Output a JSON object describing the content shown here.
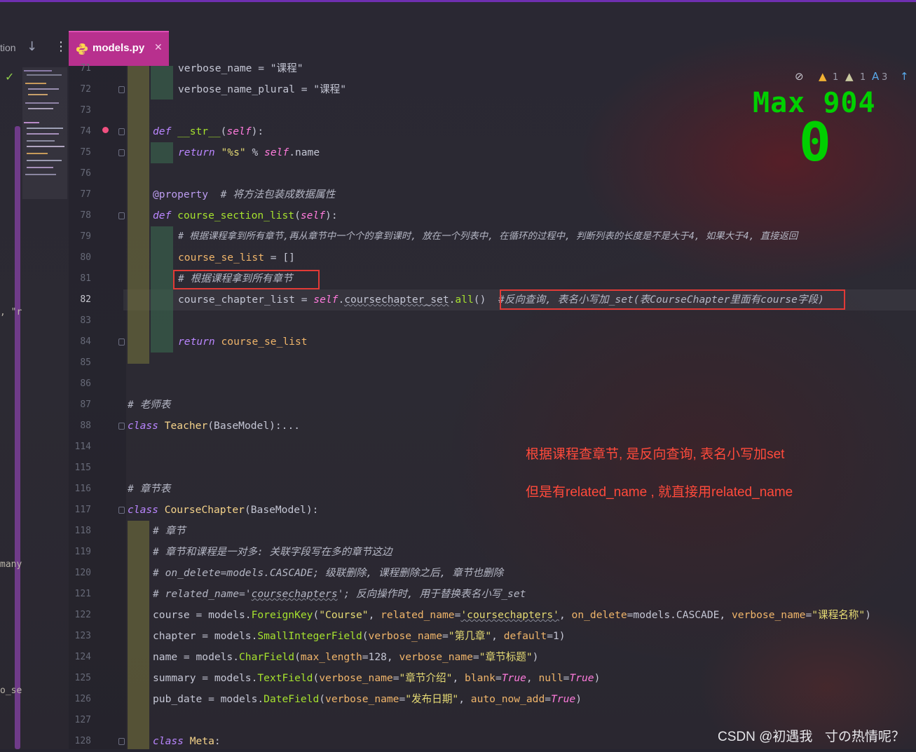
{
  "tabs": {
    "previous_label": "tion",
    "active_label": "models.py"
  },
  "left_fragments": [
    ", \"r",
    "many",
    "o_se"
  ],
  "inspections": {
    "warn1": "1",
    "warn2": "1",
    "typo": "3"
  },
  "overlay": {
    "max_label": "Max 904",
    "counter": "0"
  },
  "line_numbers": [
    "71",
    "72",
    "73",
    "74",
    "75",
    "76",
    "77",
    "78",
    "79",
    "80",
    "81",
    "82",
    "83",
    "84",
    "85",
    "86",
    "87",
    "88",
    "114",
    "115",
    "116",
    "117",
    "118",
    "119",
    "120",
    "121",
    "122",
    "123",
    "124",
    "125",
    "126",
    "127",
    "128"
  ],
  "code": {
    "l71": "verbose_name = \"课程\"",
    "l72": "verbose_name_plural = \"课程\"",
    "l74_kw": "def",
    "l74_fn": "__str__",
    "l74_self": "self",
    "l75_kw": "return",
    "l75_str": "\"%s\"",
    "l75_self": "self",
    "l75_rest": ".name",
    "l77_dec": "@property",
    "l77_cm": "# 将方法包装成数据属性",
    "l78_kw": "def",
    "l78_fn": "course_section_list",
    "l78_self": "self",
    "l79_cm": "# 根据课程拿到所有章节,再从章节中一个个的拿到课时, 放在一个列表中, 在循环的过程中, 判断列表的长度是不是大于4, 如果大于4, 直接返回",
    "l80_var": "course_se_list",
    "l80_rest": " = []",
    "l81_cm": "# 根据课程拿到所有章节",
    "l82_var": "course_chapter_list",
    "l82_self": "self",
    "l82_attr": "coursechapter_set",
    "l82_all": "all",
    "l82_cm": "#反向查询, 表名小写加_set(表CourseChapter里面有course字段)",
    "l84_kw": "return",
    "l84_var": "course_se_list",
    "l87_cm": "# 老师表",
    "l88_kw": "class",
    "l88_cls": "Teacher",
    "l88_rest": "(BaseModel):...",
    "l116_cm": "# 章节表",
    "l117_kw": "class",
    "l117_cls": "CourseChapter",
    "l117_rest": "(BaseModel):",
    "l118_cm": "# 章节",
    "l119_cm": "# 章节和课程是一对多: 关联字段写在多的章节这边",
    "l120_cm": "# on_delete=models.CASCADE; 级联删除, 课程删除之后, 章节也删除",
    "l121_cm_a": "# related_name='",
    "l121_cm_b": "coursechapters",
    "l121_cm_c": "'; 反向操作时, 用于替换表名小写_set",
    "l122": {
      "a": "course = models.",
      "b": "ForeignKey",
      "c": "(",
      "d": "\"Course\"",
      "e": ", ",
      "f": "related_name",
      "g": "=",
      "h": "'coursechapters'",
      "i": ", ",
      "j": "on_delete",
      "k": "=models.CASCADE, ",
      "l": "verbose_name",
      "m": "=",
      "n": "\"课程名称\"",
      "o": ")"
    },
    "l123": {
      "a": "chapter = models.",
      "b": "SmallIntegerField",
      "c": "(",
      "d": "verbose_name",
      "e": "=",
      "f": "\"第几章\"",
      "g": ", ",
      "h": "default",
      "i": "=1)"
    },
    "l124": {
      "a": "name = models.",
      "b": "CharField",
      "c": "(",
      "d": "max_length",
      "e": "=128, ",
      "f": "verbose_name",
      "g": "=",
      "h": "\"章节标题\"",
      "i": ")"
    },
    "l125": {
      "a": "summary = models.",
      "b": "TextField",
      "c": "(",
      "d": "verbose_name",
      "e": "=",
      "f": "\"章节介绍\"",
      "g": ", ",
      "h": "blank",
      "i": "=",
      "j": "True",
      "k": ", ",
      "l": "null",
      "m": "=",
      "n": "True",
      "o": ")"
    },
    "l126": {
      "a": "pub_date = models.",
      "b": "DateField",
      "c": "(",
      "d": "verbose_name",
      "e": "=",
      "f": "\"发布日期\"",
      "g": ", ",
      "h": "auto_now_add",
      "i": "=",
      "j": "True",
      "k": ")"
    },
    "l128_kw": "class",
    "l128_cls": "Meta"
  },
  "notes": {
    "note1": "根据课程查章节, 是反向查询, 表名小写加set",
    "note2": "但是有related_name , 就直接用related_name"
  },
  "watermark": "CSDN @初遇我ㅤ寸の热情呢？"
}
